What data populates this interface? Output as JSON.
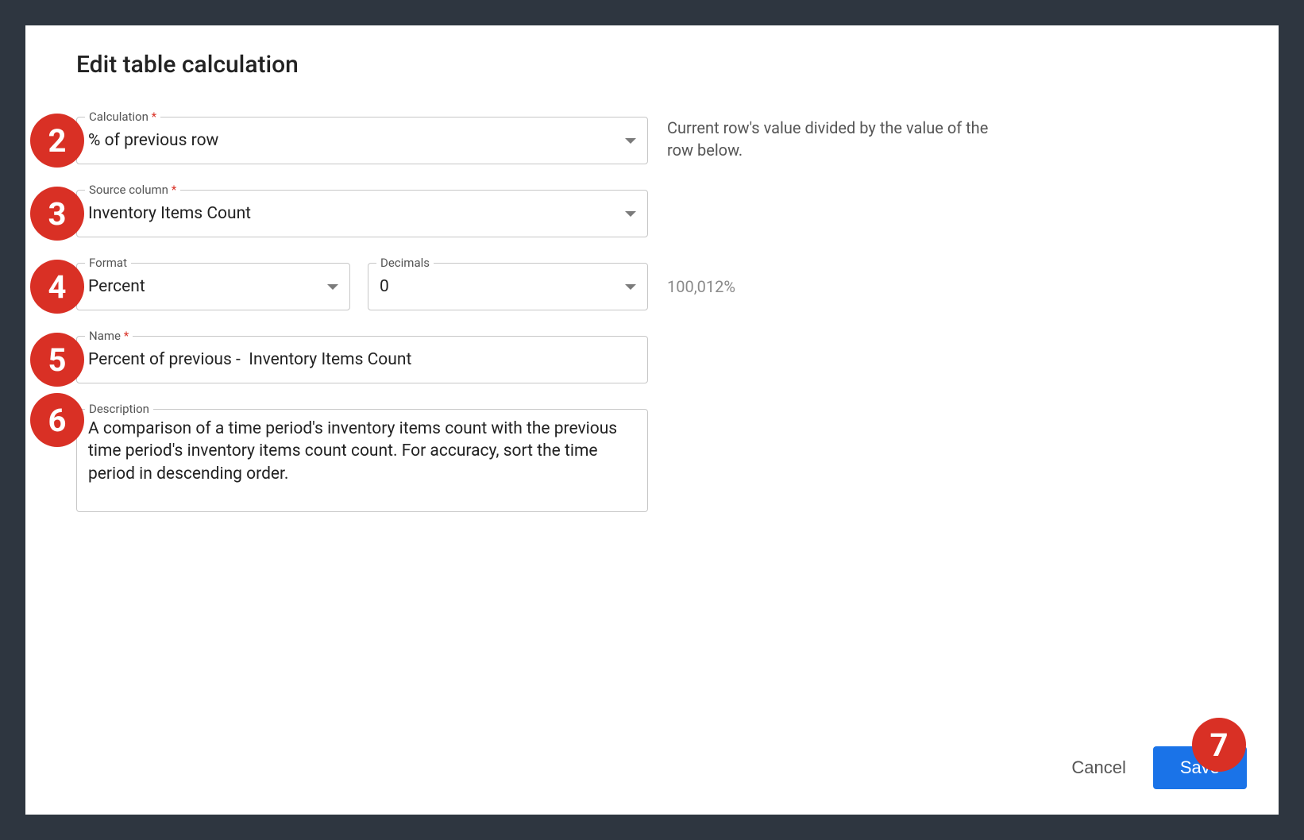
{
  "title": "Edit table calculation",
  "annotations": {
    "n2": "2",
    "n3": "3",
    "n4": "4",
    "n5": "5",
    "n6": "6",
    "n7": "7"
  },
  "fields": {
    "calculation": {
      "label": "Calculation",
      "required_mark": "*",
      "value": "% of previous row",
      "helper": "Current row's value divided by the value of the row below."
    },
    "source_column": {
      "label": "Source column",
      "required_mark": "*",
      "value": "Inventory Items Count"
    },
    "format": {
      "label": "Format",
      "value": "Percent"
    },
    "decimals": {
      "label": "Decimals",
      "value": "0"
    },
    "format_preview": "100,012%",
    "name_field": {
      "label": "Name",
      "required_mark": "*",
      "value": "Percent of previous -  Inventory Items Count"
    },
    "description": {
      "label": "Description",
      "value": "A comparison of a time period's inventory items count with the previous time period's inventory items count count. For accuracy, sort the time period in descending order."
    }
  },
  "actions": {
    "cancel": "Cancel",
    "save": "Save"
  }
}
